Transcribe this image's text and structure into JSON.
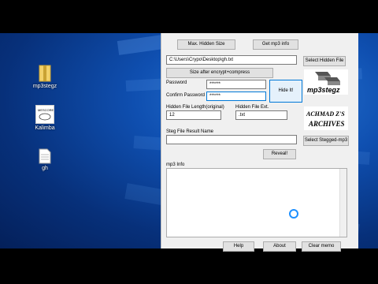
{
  "desktop": {
    "icons": [
      {
        "name": "mp3stegz-file-icon",
        "label": "mp3stegz"
      },
      {
        "name": "kalimba-file-icon",
        "label": "Kalimba"
      },
      {
        "name": "gh-file-icon",
        "label": "gh"
      }
    ],
    "kalimba_thumb_text": "MESCORE\nmp3 tune"
  },
  "app": {
    "top_buttons": {
      "max_hidden_size": "Max. Hidden Size",
      "get_mp3_info": "Get mp3 info"
    },
    "hidden_file_path": "C:\\Users\\Crypo\\Desktop\\gh.txt",
    "select_hidden_file": "Select Hidden File",
    "size_after_encrypt": "Size after encrypt+compress",
    "password_label": "Password",
    "password_value": "******",
    "confirm_label": "Confirm Password",
    "confirm_value": "******",
    "hide_it": "Hide It!",
    "hidden_length_label": "Hidden File Length(original)",
    "hidden_length_value": "12",
    "hidden_ext_label": "Hidden File Ext.",
    "hidden_ext_value": ".txt",
    "steg_result_label": "Steg File Result Name",
    "steg_result_value": "",
    "select_stegged": "Select Stegged-mp3",
    "reveal": "Reveal!",
    "mp3_info_label": "mp3 Info",
    "bottom_buttons": {
      "help": "Help",
      "about": "About",
      "clear_memo": "Clear memo"
    },
    "logo1_text": "mp3stegz",
    "logo2_text": "ACHMAD Z'S ARCHIVES"
  },
  "colors": {
    "accent": "#0078d7"
  }
}
